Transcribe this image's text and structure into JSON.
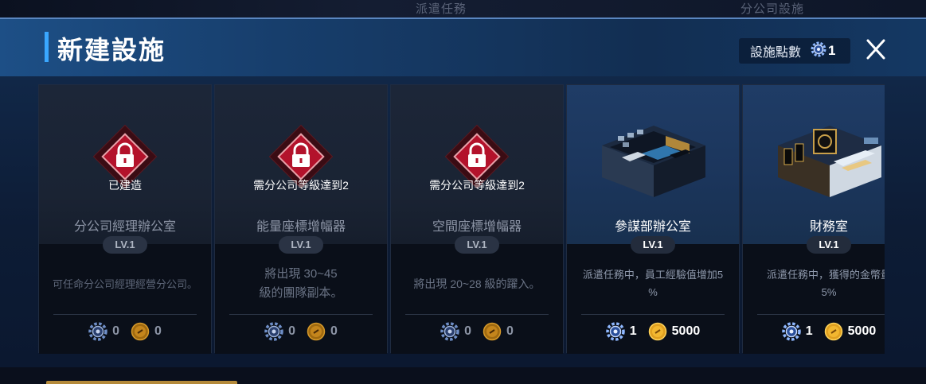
{
  "background": {
    "tab1": "派遣任務",
    "tab2": "分公司設施"
  },
  "header": {
    "title": "新建設施",
    "points_label": "設施點數",
    "points_value": "1"
  },
  "cards": [
    {
      "name": "分公司經理辦公室",
      "level": "LV.1",
      "lock_label": "已建造",
      "description": "可任命分公司經理經營分公司。",
      "gear_cost": "0",
      "coin_cost": "0"
    },
    {
      "name": "能量座標增幅器",
      "level": "LV.1",
      "lock_label": "需分公司等級達到2",
      "description_line1": "將出現 30~45",
      "description_line2": "級的團隊副本。",
      "gear_cost": "0",
      "coin_cost": "0"
    },
    {
      "name": "空間座標增幅器",
      "level": "LV.1",
      "lock_label": "需分公司等級達到2",
      "description": "將出現 20~28 級的躍入。",
      "gear_cost": "0",
      "coin_cost": "0"
    },
    {
      "name": "參謀部辦公室",
      "level": "LV.1",
      "description_line1": "派遣任務中，員工經驗值增加5",
      "description_line2": "%",
      "gear_cost": "1",
      "coin_cost": "5000"
    },
    {
      "name": "財務室",
      "level": "LV.1",
      "description_line1": "派遣任務中，獲得的金幣量",
      "description_line2": "5%",
      "gear_cost": "1",
      "coin_cost": "5000"
    }
  ],
  "colors": {
    "accent": "#3aa7ff",
    "lock_red": "#b3122b",
    "coin_gold": "#e0a020",
    "gear_blue": "#8fb8ff"
  },
  "icons": [
    "gear-icon",
    "coin-icon",
    "lock-icon",
    "close-icon"
  ]
}
